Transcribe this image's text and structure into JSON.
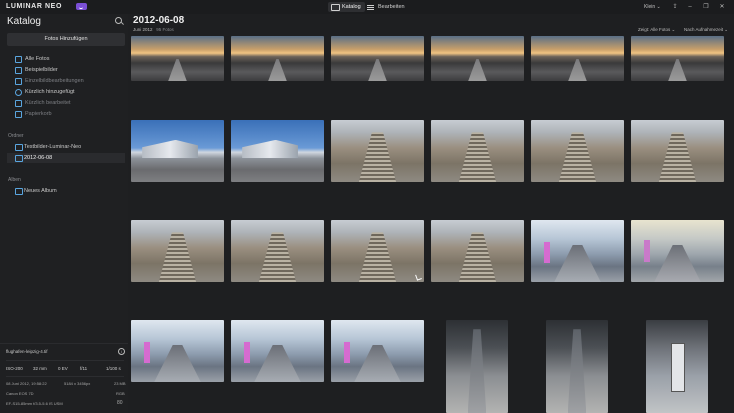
{
  "app": {
    "brand": "LUMINAR NEO",
    "modes": [
      {
        "label": "Katalog",
        "active": true
      },
      {
        "label": "Bearbeiten",
        "active": false
      }
    ],
    "size_menu": "Klein"
  },
  "sidebar": {
    "title": "Katalog",
    "add_button": "Fotos Hinzufügen",
    "nav": [
      {
        "label": "Alle Fotos",
        "icon": "photos-icon",
        "dim": false
      },
      {
        "label": "Beispielbilder",
        "icon": "sample-icon",
        "dim": false
      },
      {
        "label": "Einzelbildbearbeitungen",
        "icon": "single-edit-icon",
        "dim": true
      },
      {
        "label": "Kürzlich hinzugefügt",
        "icon": "recent-added-icon",
        "dim": false
      },
      {
        "label": "Kürzlich bearbeitet",
        "icon": "recent-edited-icon",
        "dim": true
      },
      {
        "label": "Papierkorb",
        "icon": "trash-icon",
        "dim": true
      }
    ],
    "folders_label": "Ordner",
    "folders": [
      {
        "label": "Testbilder-Luminar-Neo",
        "selected": false
      },
      {
        "label": "2012-06-08",
        "selected": true
      }
    ],
    "albums_label": "Alben",
    "albums": [
      {
        "label": "Neues Album"
      }
    ]
  },
  "info": {
    "filename": "flughafen-leipzig-4.tif",
    "exif": {
      "iso": "ISO-200",
      "focal": "32 mm",
      "ev": "0 EV",
      "aperture": "f/11",
      "shutter": "1/100 s"
    },
    "datetime": "08 Juni 2012, 19:58:22",
    "dimensions": "5184 x 3456px",
    "filesize": "23 MB",
    "camera": "Canon EOS 7D",
    "colorspace": "RGB",
    "lens": "EF-S15-85mm f/3.5-5.6 IS USM",
    "badge": "80"
  },
  "main": {
    "title": "2012-06-08",
    "subtitle_date": "Juni 2012",
    "subtitle_count": "95 Fotos",
    "filter_label": "Zeigt: Alle Fotos",
    "sort_label": "Nach Aufnahmezeit"
  },
  "thumbs": [
    {
      "kind": "sunset"
    },
    {
      "kind": "sunset"
    },
    {
      "kind": "sunset"
    },
    {
      "kind": "sunset"
    },
    {
      "kind": "sunset"
    },
    {
      "kind": "sunset"
    },
    {
      "kind": "building"
    },
    {
      "kind": "building"
    },
    {
      "kind": "escal"
    },
    {
      "kind": "escal"
    },
    {
      "kind": "escal"
    },
    {
      "kind": "escal"
    },
    {
      "kind": "escal"
    },
    {
      "kind": "escal"
    },
    {
      "kind": "escal"
    },
    {
      "kind": "escal"
    },
    {
      "kind": "walkway"
    },
    {
      "kind": "walkwarm"
    },
    {
      "kind": "walkway"
    },
    {
      "kind": "walkway"
    },
    {
      "kind": "walkway"
    },
    {
      "kind": "hall"
    },
    {
      "kind": "hall"
    },
    {
      "kind": "portrait"
    }
  ]
}
